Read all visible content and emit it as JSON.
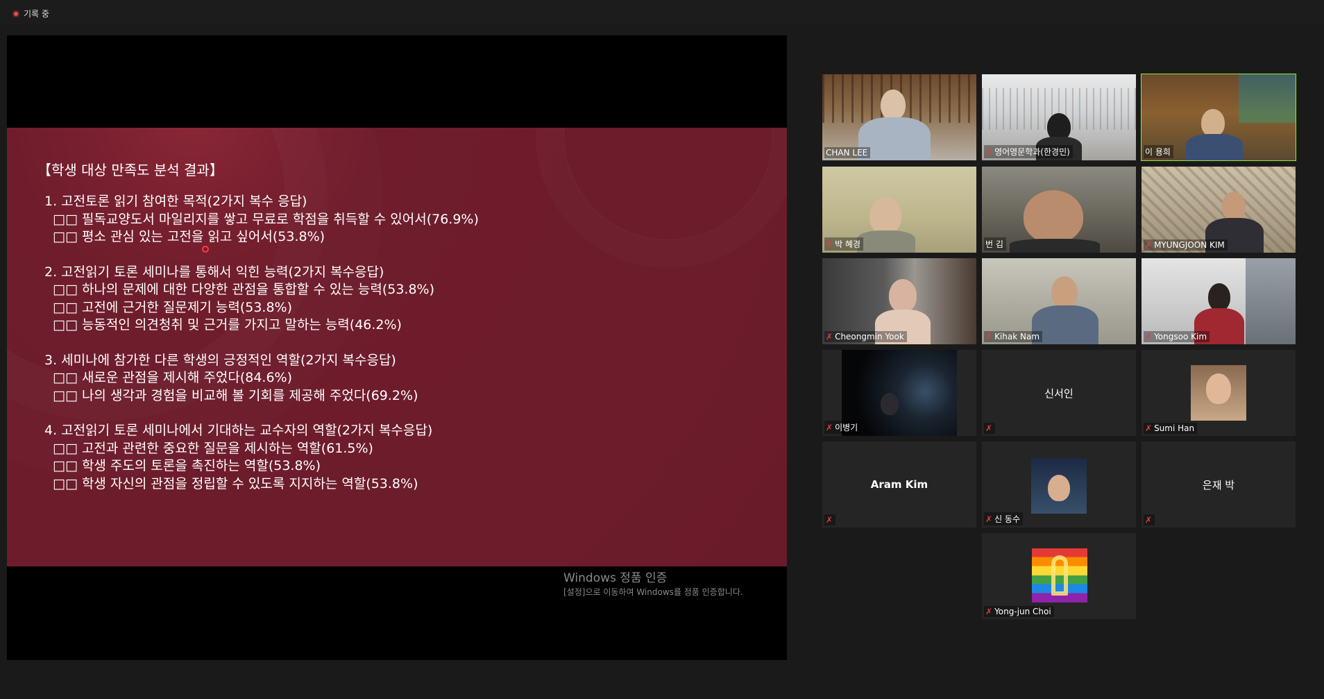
{
  "recording": {
    "label": "기록 중"
  },
  "slide": {
    "title": "【학생 대상 만족도 분석 결과】",
    "sections": [
      {
        "question": "1. 고전토론 읽기 참여한 목적(2가지 복수 응답)",
        "answers": [
          "□□ 필독교양도서 마일리지를 쌓고 무료로 학점을 취득할 수 있어서(76.9%)",
          "□□ 평소 관심 있는 고전을 읽고 싶어서(53.8%)"
        ]
      },
      {
        "question": "2. 고전읽기 토론 세미나를 통해서 익힌 능력(2가지 복수응답)",
        "answers": [
          "□□ 하나의 문제에 대한 다양한 관점을 통합할 수 있는 능력(53.8%)",
          "□□ 고전에 근거한 질문제기 능력(53.8%)",
          "□□ 능동적인 의견청취 및 근거를 가지고 말하는 능력(46.2%)"
        ]
      },
      {
        "question": "3. 세미나에 참가한 다른 학생의 긍정적인 역할(2가지 복수응답)",
        "answers": [
          "□□ 새로운 관점을 제시해 주었다(84.6%)",
          "□□ 나의 생각과 경험을 비교해 볼 기회를 제공해 주었다(69.2%)"
        ]
      },
      {
        "question": "4. 고전읽기 토론 세미나에서 기대하는 교수자의 역할(2가지 복수응답)",
        "answers": [
          "□□ 고전과 관련한 중요한 질문을 제시하는 역할(61.5%)",
          "□□ 학생 주도의 토론을 촉진하는 역할(53.8%)",
          "□□ 학생 자신의 관점을 정립할 수 있도록 지지하는 역할(53.8%)"
        ]
      }
    ]
  },
  "watermark": {
    "title": "Windows 정품 인증",
    "subtitle": "[설정]으로 이동하여 Windows를 정품 인증합니다."
  },
  "participants": [
    {
      "name": "CHAN LEE",
      "muted": false,
      "video": true
    },
    {
      "name": "영어영문학과(한경민)",
      "muted": true,
      "video": true
    },
    {
      "name": "이 용희",
      "muted": false,
      "video": true,
      "active": true
    },
    {
      "name": "박 혜경",
      "muted": true,
      "video": true
    },
    {
      "name": "번 김",
      "muted": false,
      "video": true
    },
    {
      "name": "MYUNGJOON KIM",
      "muted": true,
      "video": true
    },
    {
      "name": "Cheongmin Yook",
      "muted": true,
      "video": true
    },
    {
      "name": "Kihak Nam",
      "muted": true,
      "video": true
    },
    {
      "name": "Yongsoo Kim",
      "muted": true,
      "video": true
    },
    {
      "name": "이병기",
      "muted": true,
      "video": true
    },
    {
      "name": "신서인",
      "muted": true,
      "video": false
    },
    {
      "name": "Sumi Han",
      "muted": true,
      "video": true
    },
    {
      "name": "Aram Kim",
      "muted": true,
      "video": false
    },
    {
      "name": "신 동수",
      "muted": true,
      "video": true
    },
    {
      "name": "은재 박",
      "muted": true,
      "video": false
    },
    {
      "name": "Yong-jun Choi",
      "muted": true,
      "video": true
    }
  ]
}
